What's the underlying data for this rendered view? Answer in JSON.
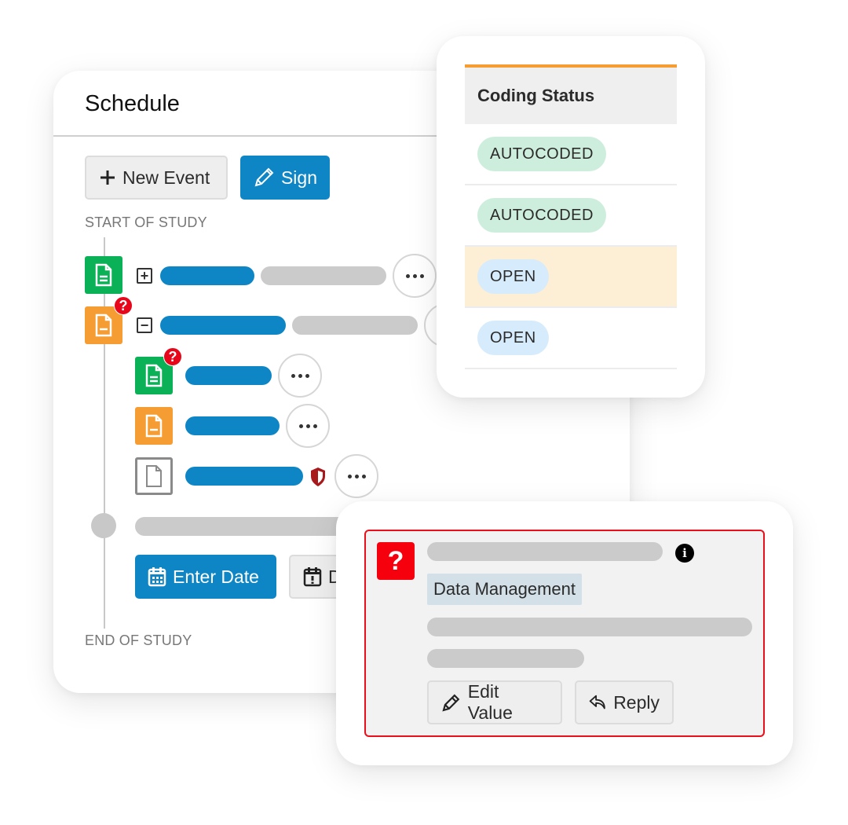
{
  "schedule": {
    "title": "Schedule",
    "new_event_label": "New Event",
    "sign_label": "Sign",
    "start_label": "START OF STUDY",
    "end_label": "END OF STUDY",
    "enter_date_label": "Enter Date",
    "second_date_label": "D",
    "events": [
      {
        "status": "complete",
        "color": "#0ab157",
        "expanded": false,
        "has_query": false
      },
      {
        "status": "incomplete",
        "color": "#f59c33",
        "expanded": true,
        "has_query": true,
        "forms": [
          {
            "status": "complete",
            "color": "#0ab157",
            "has_query": true,
            "locked": false
          },
          {
            "status": "incomplete",
            "color": "#f59c33",
            "has_query": false,
            "locked": false
          },
          {
            "status": "not-started",
            "color": "#8a8a8a",
            "has_query": false,
            "locked": true
          }
        ]
      }
    ],
    "query_badge": "?",
    "expand_symbol": "+",
    "collapse_symbol": "−"
  },
  "coding_status": {
    "header": "Coding Status",
    "header_accent": "#f59c33",
    "rows": [
      {
        "status": "AUTOCODED",
        "highlighted": false
      },
      {
        "status": "AUTOCODED",
        "highlighted": false
      },
      {
        "status": "OPEN",
        "highlighted": true
      },
      {
        "status": "OPEN",
        "highlighted": false
      }
    ]
  },
  "query": {
    "icon": "?",
    "info_icon": "i",
    "tag": "Data Management",
    "edit_value_label": "Edit Value",
    "reply_label": "Reply",
    "border_color": "#ea0f1a"
  },
  "colors": {
    "primary": "#0e86c5",
    "placeholder": "#cbcbcb"
  }
}
